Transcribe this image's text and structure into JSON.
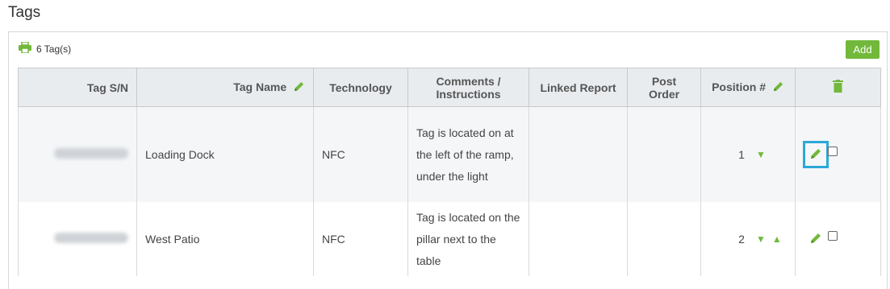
{
  "page": {
    "title": "Tags"
  },
  "toolbar": {
    "count_label": "6 Tag(s)",
    "add_label": "Add"
  },
  "table": {
    "headers": {
      "sn": "Tag S/N",
      "name": "Tag Name",
      "technology": "Technology",
      "comments": "Comments / Instructions",
      "linked_report": "Linked Report",
      "post_order": "Post Order",
      "position": "Position #"
    },
    "rows": [
      {
        "sn": "",
        "name": "Loading Dock",
        "technology": "NFC",
        "comments": "Tag is located on at the left of the ramp, under the light",
        "linked_report": "",
        "post_order": "",
        "position": "1"
      },
      {
        "sn": "",
        "name": "West Patio",
        "technology": "NFC",
        "comments": "Tag is located on the pillar next to the table",
        "linked_report": "",
        "post_order": "",
        "position": "2"
      }
    ]
  },
  "colors": {
    "accent": "#72b83a",
    "header_bg": "#e9ecef",
    "highlight": "#2aa8d8"
  },
  "icons": {
    "print": "printer-icon",
    "edit": "pencil-icon",
    "delete": "trash-icon",
    "down": "arrow-down-icon",
    "up": "arrow-up-icon"
  }
}
